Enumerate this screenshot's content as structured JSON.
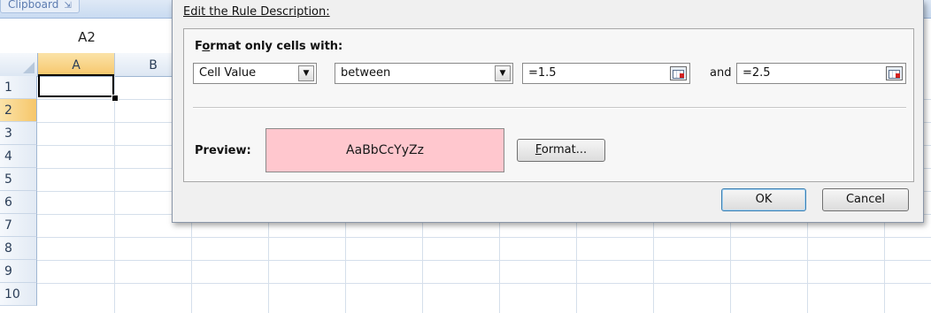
{
  "ribbon": {
    "clipboard_label": "Clipboard",
    "clipboard_expander": "⇲"
  },
  "namebox": {
    "value": "A2"
  },
  "sheet": {
    "columns": [
      "A",
      "B"
    ],
    "rows": [
      "1",
      "2",
      "3",
      "4",
      "5",
      "6",
      "7",
      "8",
      "9",
      "10"
    ],
    "active_cell": "A2"
  },
  "dialog": {
    "section_label": "Edit the Rule Description:",
    "format_only_prefix": "F",
    "format_only_underlined": "o",
    "format_only_rest": "rmat only cells with:",
    "condition_type": "Cell Value",
    "operator": "between",
    "value1": "=1.5",
    "and_label": "and",
    "value2": "=2.5",
    "preview_label": "Preview:",
    "preview_text": "AaBbCcYyZz",
    "preview_fill": "#ffc7ce",
    "format_button_underlined": "F",
    "format_button_rest": "ormat...",
    "ok_label": "OK",
    "cancel_label": "Cancel"
  },
  "icons": {
    "dropdown": "dropdown-arrow-icon",
    "range_select": "collapse-dialog-icon"
  }
}
